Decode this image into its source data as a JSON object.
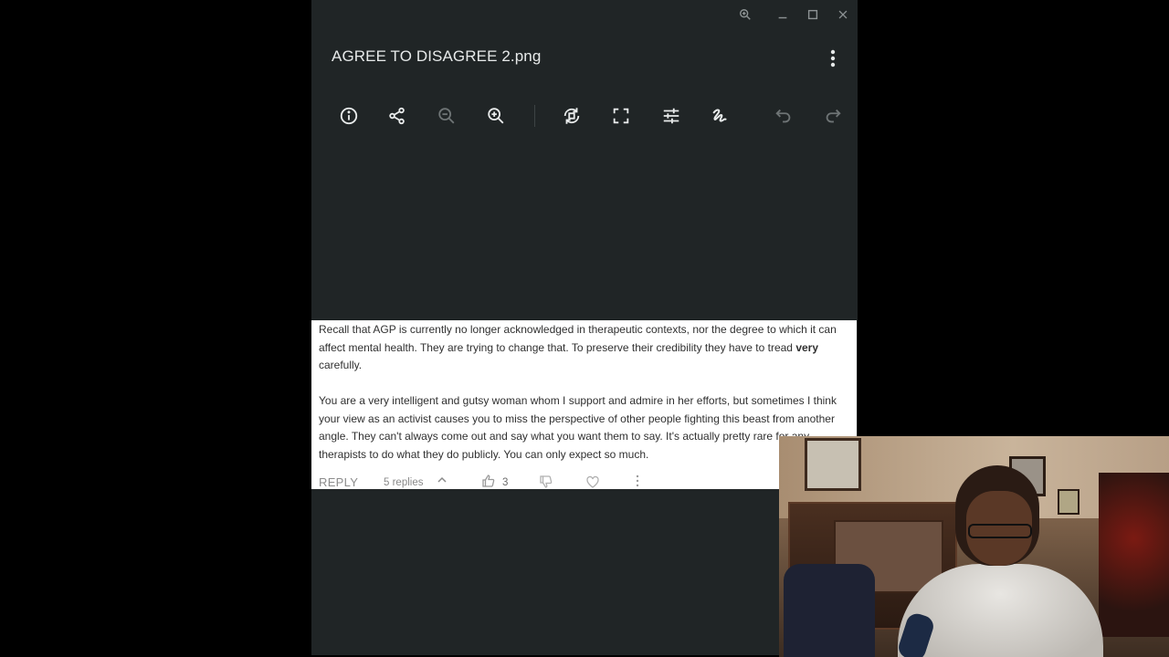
{
  "window": {
    "title": "AGREE TO DISAGREE 2.png"
  },
  "toolbar": {
    "tools": [
      {
        "name": "info-icon"
      },
      {
        "name": "share-icon"
      },
      {
        "name": "zoom-out-icon"
      },
      {
        "name": "zoom-in-icon"
      },
      {
        "name": "rotate-icon"
      },
      {
        "name": "crop-icon"
      },
      {
        "name": "adjust-icon"
      },
      {
        "name": "annotate-icon"
      },
      {
        "name": "undo-icon"
      },
      {
        "name": "redo-icon"
      }
    ]
  },
  "comment": {
    "para1_text": "Recall that AGP is currently no longer acknowledged in therapeutic contexts, nor the degree to which it can affect mental health. They are trying to change that. To preserve their credibility they have to tread ",
    "para1_bold": "very",
    "para1_end": " carefully.",
    "para2_text": "You are a very intelligent and gutsy woman whom I support and admire in her efforts, but sometimes I think your view as an activist causes you to miss the perspective of other people fighting this beast from another angle. They can't always come out and say what you want them to say. It's actually pretty rare for any therapists to do what they do publicly. You can only expect so much.",
    "reply_label": "REPLY",
    "replies_label": "5 replies",
    "like_count": "3"
  },
  "colors": {
    "viewer_bg": "#202526",
    "icon": "#e8ebeb",
    "icon_dim": "#6e7475"
  }
}
